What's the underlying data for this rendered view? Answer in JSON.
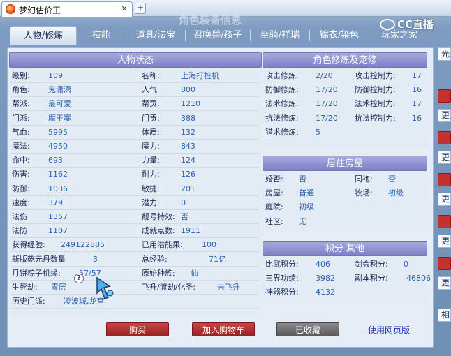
{
  "browser": {
    "tab_title": "梦幻估价王",
    "close": "✕",
    "new_tab": "+"
  },
  "watermark": "CC直播",
  "header": "角色装备信息",
  "nav": [
    "人物/修炼",
    "技能",
    "道具/法宝",
    "召唤兽/孩子",
    "坐骑/祥瑞",
    "锦衣/染色",
    "玩家之家"
  ],
  "panels": {
    "status_title": "人物状态",
    "cultivation_title": "角色修炼及宠修",
    "house_title": "居住房屋",
    "score_title": "积分 其他"
  },
  "status_left": [
    {
      "label": "级别:",
      "value": "109"
    },
    {
      "label": "角色:",
      "value": "鬼潇潇"
    },
    {
      "label": "帮派:",
      "value": "最可爱"
    },
    {
      "label": "门派:",
      "value": "魔王寨"
    },
    {
      "label": "气血:",
      "value": "5995"
    },
    {
      "label": "魔法:",
      "value": "4950"
    },
    {
      "label": "命中:",
      "value": "693"
    },
    {
      "label": "伤害:",
      "value": "1162"
    },
    {
      "label": "防御:",
      "value": "1036"
    },
    {
      "label": "速度:",
      "value": "379"
    },
    {
      "label": "法伤",
      "value": "1357"
    },
    {
      "label": "法防",
      "value": "1107"
    }
  ],
  "status_right": [
    {
      "label": "名称:",
      "value": "上海打桩机"
    },
    {
      "label": "人气",
      "value": "800"
    },
    {
      "label": "帮贡:",
      "value": "1210"
    },
    {
      "label": "门贡:",
      "value": "388"
    },
    {
      "label": "体质:",
      "value": "132"
    },
    {
      "label": "魔力:",
      "value": "843"
    },
    {
      "label": "力量:",
      "value": "124"
    },
    {
      "label": "耐力:",
      "value": "126"
    },
    {
      "label": "敏捷:",
      "value": "201"
    },
    {
      "label": "潜力:",
      "value": "0"
    },
    {
      "label": "靓号特效:",
      "value": "否"
    },
    {
      "label": "成就点数:",
      "value": "1911"
    }
  ],
  "status_wide_left": [
    {
      "label": "获得经验:",
      "value": "249122885"
    },
    {
      "label": "新版乾元丹数量",
      "value": "3"
    },
    {
      "label": "月饼粽子机缘:",
      "value": "57/57"
    },
    {
      "label": "生死劫:",
      "value": "零层"
    },
    {
      "label": "历史门派:",
      "value": "凌波城,龙宫"
    }
  ],
  "status_wide_right": [
    {
      "label": "已用潜能果:",
      "value": "100"
    },
    {
      "label": "总经验:",
      "value": "71亿"
    },
    {
      "label": "原始种族:",
      "value": "仙"
    },
    {
      "label": "飞升/渡劫/化圣:",
      "value": "未飞升"
    }
  ],
  "help_badge": "?",
  "cultivation_left": [
    {
      "label": "攻击修炼:",
      "value": "2/20"
    },
    {
      "label": "防御修炼:",
      "value": "17/20"
    },
    {
      "label": "法术修炼:",
      "value": "17/20"
    },
    {
      "label": "抗法修炼:",
      "value": "17/20"
    },
    {
      "label": "猎术修炼:",
      "value": "5"
    }
  ],
  "cultivation_right": [
    {
      "label": "攻击控制力:",
      "value": "17"
    },
    {
      "label": "防御控制力:",
      "value": "16"
    },
    {
      "label": "法术控制力:",
      "value": "17"
    },
    {
      "label": "抗法控制力:",
      "value": "16"
    }
  ],
  "house_left": [
    {
      "label": "婚否:",
      "value": "否"
    },
    {
      "label": "房屋:",
      "value": "普通"
    },
    {
      "label": "庭院:",
      "value": "初级"
    },
    {
      "label": "社区:",
      "value": "无"
    }
  ],
  "house_right": [
    {
      "label": "同袍:",
      "value": "否"
    },
    {
      "label": "牧场:",
      "value": "初级"
    }
  ],
  "score_left": [
    {
      "label": "比武积分:",
      "value": "406"
    },
    {
      "label": "三界功绩:",
      "value": "3982"
    },
    {
      "label": "神器积分:",
      "value": "4132"
    }
  ],
  "score_right": [
    {
      "label": "剑会积分:",
      "value": "0"
    },
    {
      "label": "副本积分:",
      "value": "46806"
    }
  ],
  "actions": {
    "buy": "购买",
    "add_cart": "加入购物车",
    "collected": "已收藏",
    "web_version": "使用网页版"
  },
  "side": {
    "top": "光",
    "more": "更",
    "bottom": "相"
  }
}
